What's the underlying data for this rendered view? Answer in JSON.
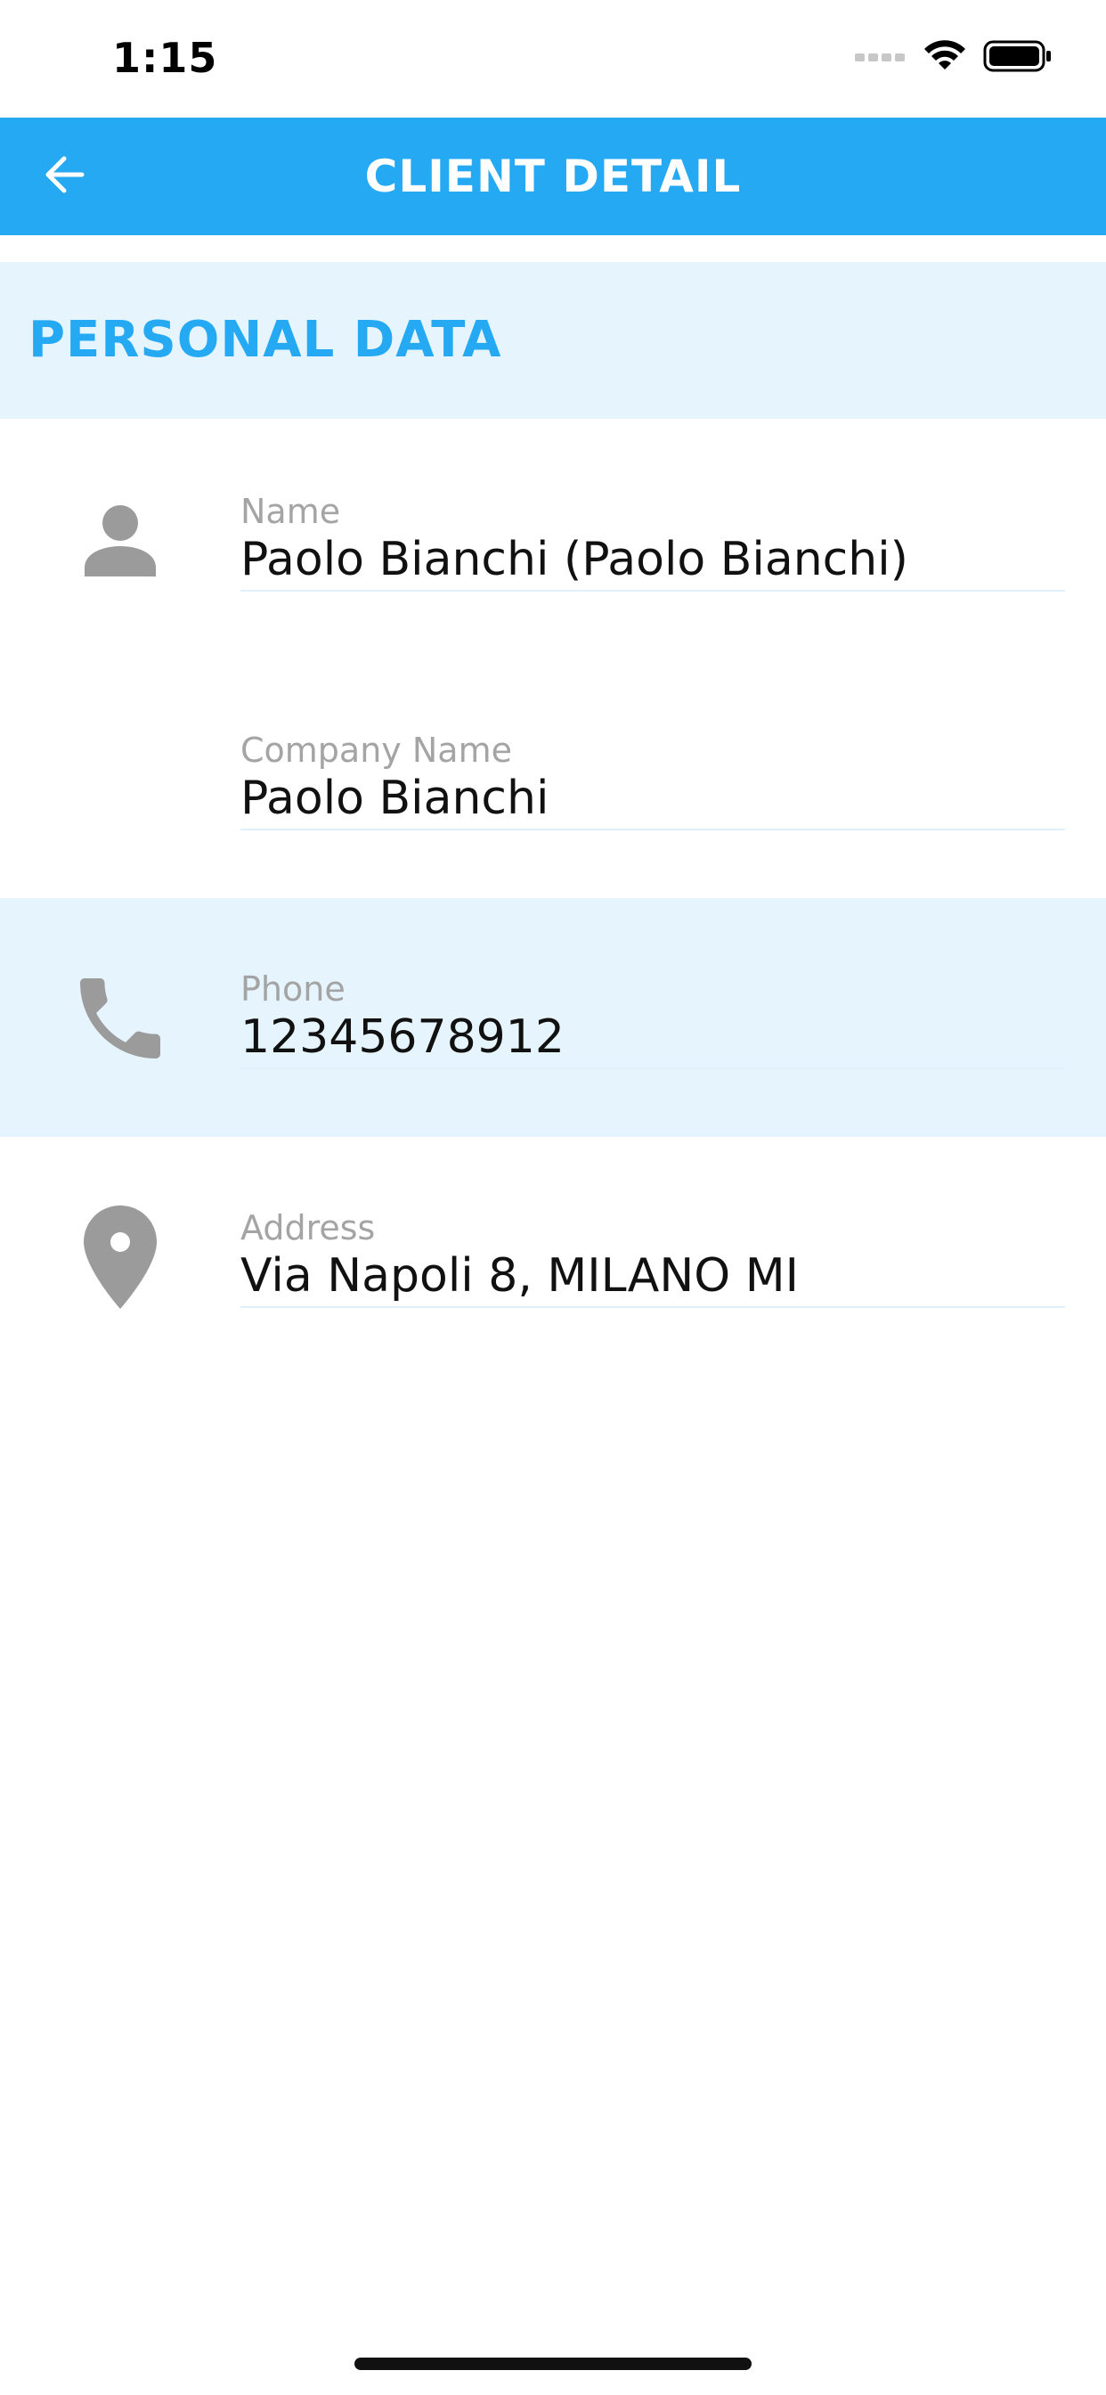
{
  "status_bar": {
    "time": "1:15"
  },
  "nav": {
    "title": "CLIENT DETAIL"
  },
  "section": {
    "title": "PERSONAL DATA"
  },
  "fields": {
    "name": {
      "label": "Name",
      "value": "Paolo Bianchi (Paolo Bianchi)"
    },
    "company": {
      "label": "Company Name",
      "value": "Paolo Bianchi"
    },
    "phone": {
      "label": "Phone",
      "value": "12345678912"
    },
    "address": {
      "label": "Address",
      "value": "Via Napoli 8,  MILANO MI"
    }
  },
  "colors": {
    "accent": "#25A9F2",
    "highlight_bg": "#E5F4FD",
    "icon_gray": "#9B9B9B",
    "label_gray": "#A4A4A4"
  },
  "icons": {
    "back": "arrow-left-icon",
    "name": "person-icon",
    "phone": "phone-icon",
    "address": "location-pin-icon",
    "signal": "signal-dots-icon",
    "wifi": "wifi-icon",
    "battery": "battery-icon"
  }
}
